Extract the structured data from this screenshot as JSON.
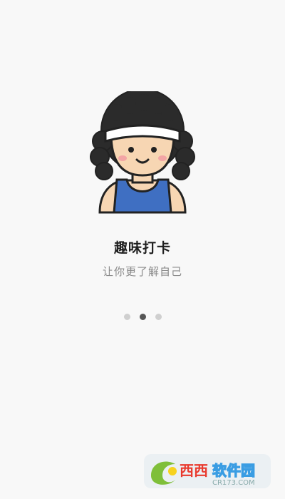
{
  "onboarding": {
    "title": "趣味打卡",
    "subtitle": "让你更了解自己",
    "page_indicator": {
      "total_pages": 3,
      "current_page": 2
    },
    "illustration": "cartoon-avatar-with-headband"
  },
  "watermark": {
    "brand_text": "西西软件园",
    "url_text": "CR173.COM"
  },
  "colors": {
    "background": "#f8f8f8",
    "title": "#1f1f1f",
    "subtitle": "#8a8a8a",
    "dot_active": "#555555",
    "dot_inactive": "#cfcfcf",
    "shirt": "#3f6fc2",
    "skin": "#f7d6b3",
    "hair": "#2b2b2b"
  }
}
